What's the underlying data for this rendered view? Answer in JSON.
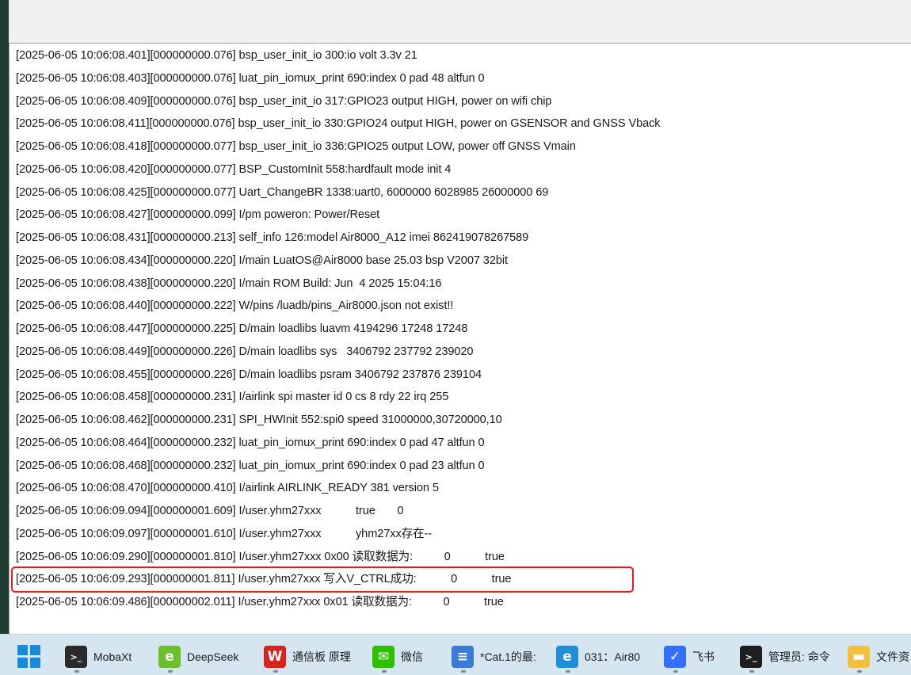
{
  "log": {
    "lines": [
      "[2025-06-05 10:06:08.401][000000000.076] bsp_user_init_io 300:io volt 3.3v 21",
      "[2025-06-05 10:06:08.403][000000000.076] luat_pin_iomux_print 690:index 0 pad 48 altfun 0",
      "[2025-06-05 10:06:08.409][000000000.076] bsp_user_init_io 317:GPIO23 output HIGH, power on wifi chip",
      "[2025-06-05 10:06:08.411][000000000.076] bsp_user_init_io 330:GPIO24 output HIGH, power on GSENSOR and GNSS Vback",
      "[2025-06-05 10:06:08.418][000000000.077] bsp_user_init_io 336:GPIO25 output LOW, power off GNSS Vmain",
      "[2025-06-05 10:06:08.420][000000000.077] BSP_CustomInit 558:hardfault mode init 4",
      "[2025-06-05 10:06:08.425][000000000.077] Uart_ChangeBR 1338:uart0, 6000000 6028985 26000000 69",
      "[2025-06-05 10:06:08.427][000000000.099] I/pm poweron: Power/Reset",
      "[2025-06-05 10:06:08.431][000000000.213] self_info 126:model Air8000_A12 imei 862419078267589",
      "[2025-06-05 10:06:08.434][000000000.220] I/main LuatOS@Air8000 base 25.03 bsp V2007 32bit",
      "[2025-06-05 10:06:08.438][000000000.220] I/main ROM Build: Jun  4 2025 15:04:16",
      "[2025-06-05 10:06:08.440][000000000.222] W/pins /luadb/pins_Air8000.json not exist!!",
      "[2025-06-05 10:06:08.447][000000000.225] D/main loadlibs luavm 4194296 17248 17248",
      "[2025-06-05 10:06:08.449][000000000.226] D/main loadlibs sys   3406792 237792 239020",
      "[2025-06-05 10:06:08.455][000000000.226] D/main loadlibs psram 3406792 237876 239104",
      "[2025-06-05 10:06:08.458][000000000.231] I/airlink spi master id 0 cs 8 rdy 22 irq 255",
      "[2025-06-05 10:06:08.462][000000000.231] SPI_HWInit 552:spi0 speed 31000000,30720000,10",
      "[2025-06-05 10:06:08.464][000000000.232] luat_pin_iomux_print 690:index 0 pad 47 altfun 0",
      "[2025-06-05 10:06:08.468][000000000.232] luat_pin_iomux_print 690:index 0 pad 23 altfun 0",
      "[2025-06-05 10:06:08.470][000000000.410] I/airlink AIRLINK_READY 381 version 5",
      "[2025-06-05 10:06:09.094][000000001.609] I/user.yhm27xxx           true       0",
      "[2025-06-05 10:06:09.097][000000001.610] I/user.yhm27xxx           yhm27xx存在--",
      "[2025-06-05 10:06:09.290][000000001.810] I/user.yhm27xxx 0x00 读取数据为:          0           true",
      "[2025-06-05 10:06:09.293][000000001.811] I/user.yhm27xxx 写入V_CTRL成功:           0           true",
      "[2025-06-05 10:06:09.486][000000002.011] I/user.yhm27xxx 0x01 读取数据为:          0           true"
    ],
    "highlighted_index": 23,
    "highlight_color": "#e81b23"
  },
  "taskbar": {
    "items": [
      {
        "label": "MobaXt",
        "icon": "mobaxterm-icon",
        "color": "#2a2a2a",
        "glyph": ">_"
      },
      {
        "label": "DeepSeek",
        "icon": "edge-dev-icon",
        "color": "#6cbf2a",
        "glyph": "e"
      },
      {
        "label": "通信板 原理",
        "icon": "wps-icon",
        "color": "#d9231d",
        "glyph": "W"
      },
      {
        "label": "微信",
        "icon": "wechat-icon",
        "color": "#2dc100",
        "glyph": "✉"
      },
      {
        "label": "*Cat.1的最:",
        "icon": "notepad-icon",
        "color": "#3a7bd5",
        "glyph": "≡"
      },
      {
        "label": "031：Air80",
        "icon": "edge-icon",
        "color": "#1e8fd6",
        "glyph": "e"
      },
      {
        "label": "飞书",
        "icon": "feishu-icon",
        "color": "#3370ff",
        "glyph": "✓"
      },
      {
        "label": "管理员: 命令",
        "icon": "terminal-icon",
        "color": "#1e1e1e",
        "glyph": ">_"
      },
      {
        "label": "文件资",
        "icon": "folder-icon",
        "color": "#f3c03c",
        "glyph": "▬"
      }
    ]
  }
}
